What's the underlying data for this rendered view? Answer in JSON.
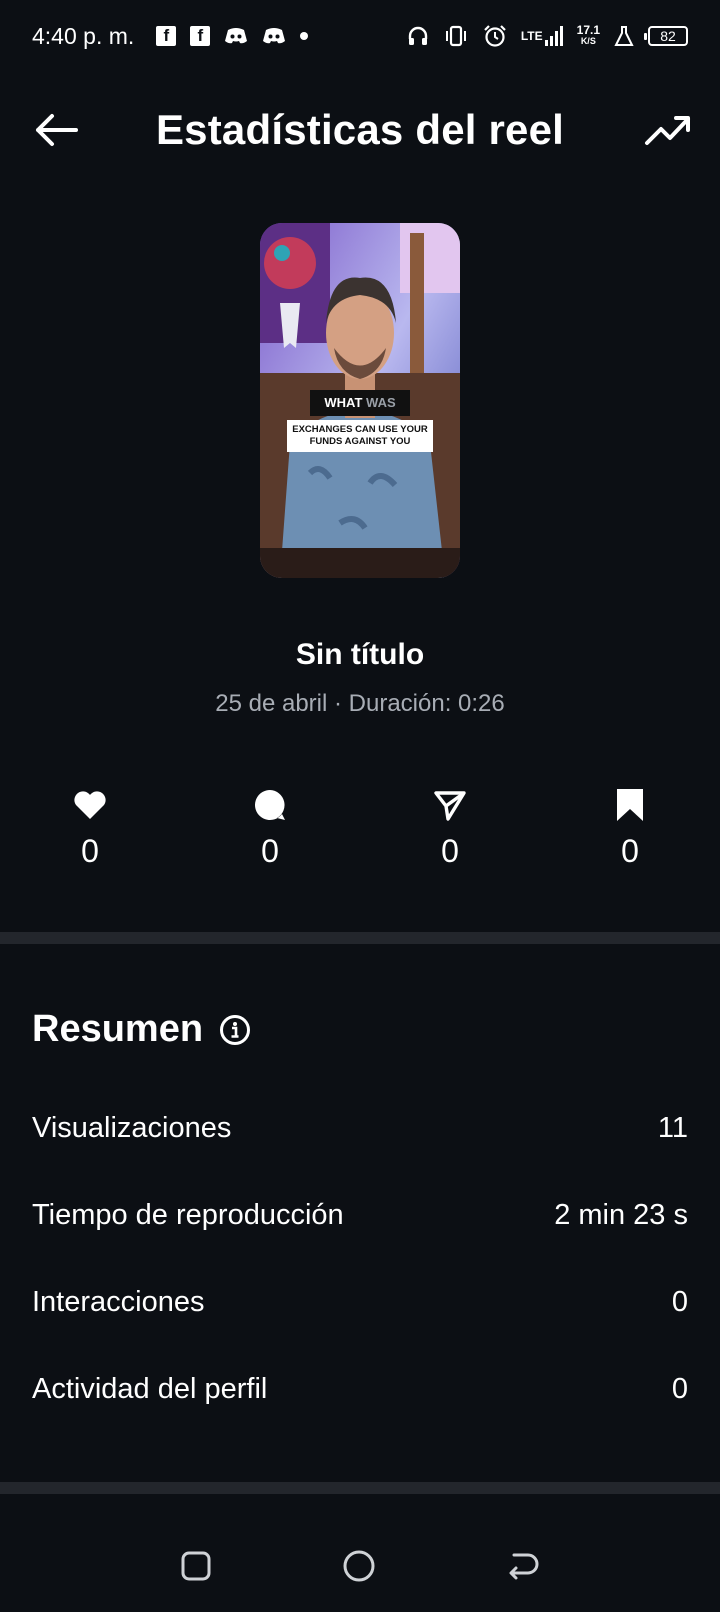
{
  "status_bar": {
    "time": "4:40 p. m.",
    "network": "LTE",
    "speed_value": "17.1",
    "speed_unit": "K/S",
    "battery": "82",
    "icons": [
      "facebook-icon",
      "facebook-icon",
      "discord-icon",
      "discord-icon",
      "headphones-icon",
      "vibrate-icon",
      "alarm-icon",
      "signal-icon",
      "lab-icon",
      "battery-icon"
    ]
  },
  "header": {
    "title": "Estadísticas del reel",
    "back_icon": "back-arrow-icon",
    "trend_icon": "trending-up-icon"
  },
  "reel": {
    "overlay_text_1a": "WHAT",
    "overlay_text_1b": "WAS",
    "overlay_text_2": "EXCHANGES CAN USE YOUR FUNDS AGAINST YOU",
    "title": "Sin título",
    "meta": "25 de abril · Duración: 0:26"
  },
  "engagement": [
    {
      "icon": "heart-icon",
      "count": "0"
    },
    {
      "icon": "comment-icon",
      "count": "0"
    },
    {
      "icon": "share-icon",
      "count": "0"
    },
    {
      "icon": "bookmark-icon",
      "count": "0"
    }
  ],
  "summary": {
    "title": "Resumen",
    "info_icon": "info-icon",
    "metrics": [
      {
        "label": "Visualizaciones",
        "value": "11"
      },
      {
        "label": "Tiempo de reproducción",
        "value": "2 min 23 s"
      },
      {
        "label": "Interacciones",
        "value": "0"
      },
      {
        "label": "Actividad del perfil",
        "value": "0"
      }
    ]
  },
  "colors": {
    "background": "#0c0f14",
    "text": "#ffffff",
    "muted_text": "#a8adb5",
    "divider": "#23262c"
  }
}
